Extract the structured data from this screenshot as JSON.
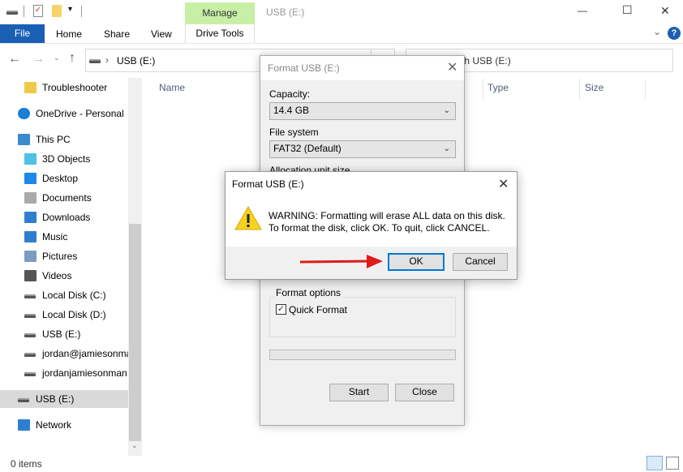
{
  "titlebar": {
    "manage_tab": "Manage",
    "window_title": "USB (E:)",
    "minimize": "—",
    "maximize": "☐",
    "close": "✕"
  },
  "ribbon": {
    "tabs": [
      "File",
      "Home",
      "Share",
      "View",
      "Drive Tools"
    ],
    "help": "?",
    "collapse": "⌄"
  },
  "address": {
    "path": "USB (E:)",
    "search_placeholder": "Search USB (E:)"
  },
  "columns": [
    "Name",
    "Type",
    "Size"
  ],
  "sidebar": {
    "items": [
      {
        "label": "Troubleshooter",
        "icon": "folder-icon"
      },
      {
        "label": "OneDrive - Personal",
        "icon": "cloud-icon"
      },
      {
        "label": "This PC",
        "icon": "computer-icon"
      },
      {
        "label": "3D Objects",
        "icon": "cube-icon"
      },
      {
        "label": "Desktop",
        "icon": "desktop-icon"
      },
      {
        "label": "Documents",
        "icon": "documents-icon"
      },
      {
        "label": "Downloads",
        "icon": "download-icon"
      },
      {
        "label": "Music",
        "icon": "music-icon"
      },
      {
        "label": "Pictures",
        "icon": "pictures-icon"
      },
      {
        "label": "Videos",
        "icon": "videos-icon"
      },
      {
        "label": "Local Disk (C:)",
        "icon": "drive-icon"
      },
      {
        "label": "Local Disk (D:)",
        "icon": "drive-icon"
      },
      {
        "label": "USB (E:)",
        "icon": "drive-icon"
      },
      {
        "label": "jordan@jamiesonma",
        "icon": "drive-icon"
      },
      {
        "label": "jordanjamiesonman",
        "icon": "drive-icon"
      },
      {
        "label": "USB (E:)",
        "icon": "drive-icon",
        "selected": true
      },
      {
        "label": "Network",
        "icon": "network-icon"
      }
    ]
  },
  "status": {
    "items": "0 items"
  },
  "format_dialog": {
    "title": "Format USB (E:)",
    "capacity_label": "Capacity:",
    "capacity_value": "14.4 GB",
    "fs_label": "File system",
    "fs_value": "FAT32 (Default)",
    "alloc_label": "Allocation unit size",
    "options_label": "Format options",
    "quick_format": "Quick Format",
    "quick_format_checked": true,
    "progress": 0,
    "start": "Start",
    "close": "Close"
  },
  "warning_dialog": {
    "title": "Format USB (E:)",
    "line1": "WARNING: Formatting will erase ALL data on this disk.",
    "line2": "To format the disk, click OK. To quit, click CANCEL.",
    "ok": "OK",
    "cancel": "Cancel"
  },
  "colors": {
    "file_tab": "#1a5fb4",
    "manage_tab": "#c7efa6",
    "arrow": "#e01b1b",
    "ok_border": "#0078d7"
  }
}
